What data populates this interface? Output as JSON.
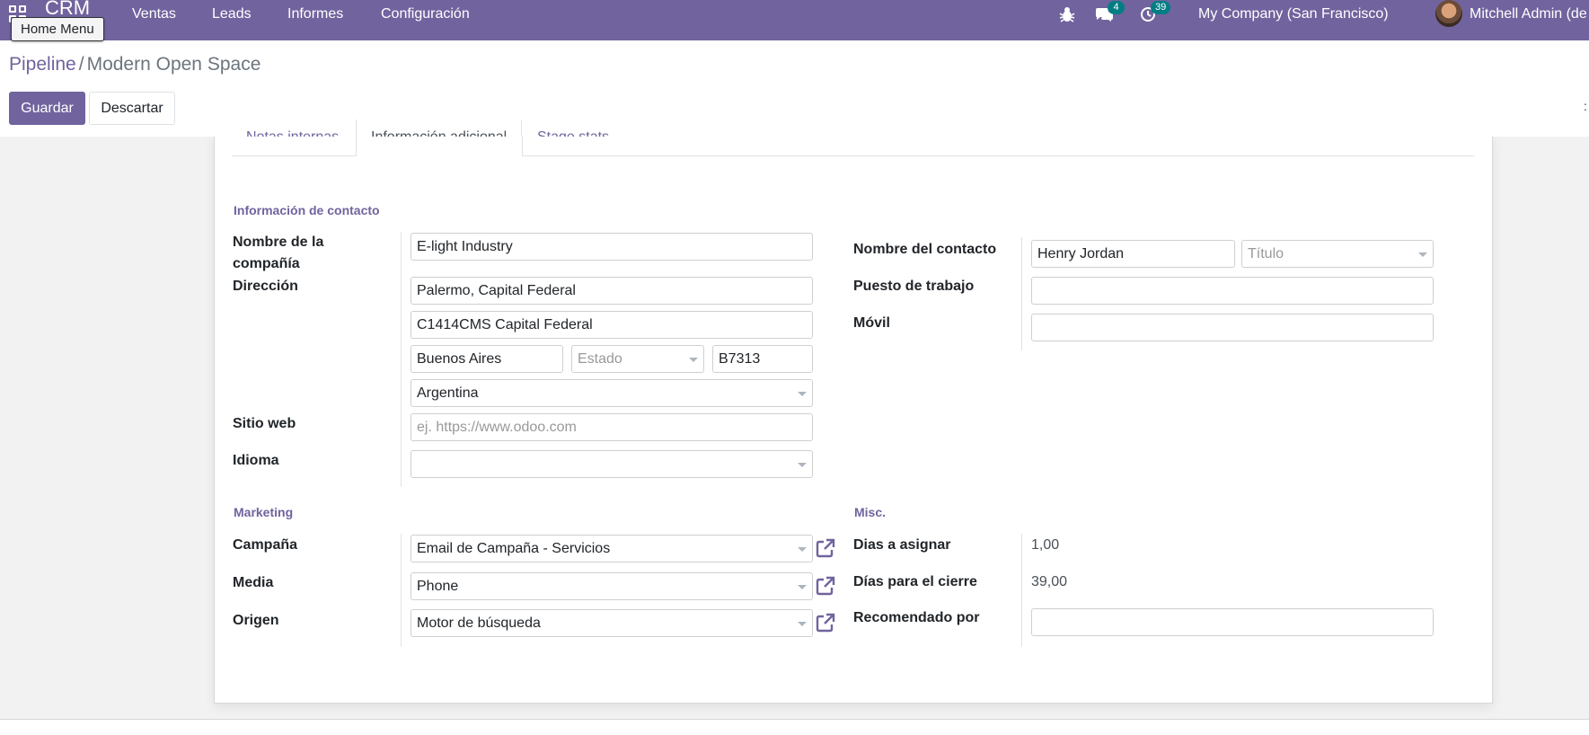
{
  "navbar": {
    "app_name": "CRM",
    "menu": [
      "Ventas",
      "Leads",
      "Informes",
      "Configuración"
    ],
    "tooltip": "Home Menu",
    "messages_count": "4",
    "activities_count": "39",
    "company": "My Company (San Francisco)",
    "user": "Mitchell Admin (de"
  },
  "breadcrumb": {
    "parent": "Pipeline",
    "separator": "/",
    "current": "Modern Open Space"
  },
  "buttons": {
    "save": "Guardar",
    "discard": "Descartar"
  },
  "tabs": [
    "Notas internas",
    "Información adicional",
    "Stage stats"
  ],
  "contact_section": {
    "title": "Información de contacto",
    "company_name_label": "Nombre de la compañía",
    "company_name": "E-light Industry",
    "address_label": "Dirección",
    "street": "Palermo, Capital Federal",
    "street2": "C1414CMS Capital Federal",
    "city": "Buenos Aires",
    "state_placeholder": "Estado",
    "zip": "B7313",
    "country": "Argentina",
    "website_label": "Sitio web",
    "website_placeholder": "ej. https://www.odoo.com",
    "language_label": "Idioma",
    "language": ""
  },
  "contact_right": {
    "contact_name_label": "Nombre del contacto",
    "contact_name": "Henry Jordan",
    "title_placeholder": "Título",
    "job_position_label": "Puesto de trabajo",
    "job_position": "",
    "mobile_label": "Móvil",
    "mobile": ""
  },
  "marketing": {
    "title": "Marketing",
    "campaign_label": "Campaña",
    "campaign": "Email de Campaña - Servicios",
    "medium_label": "Media",
    "medium": "Phone",
    "source_label": "Origen",
    "source": "Motor de búsqueda"
  },
  "misc": {
    "title": "Misc.",
    "days_to_assign_label": "Dias a asignar",
    "days_to_assign": "1,00",
    "days_to_close_label": "Días para el cierre",
    "days_to_close": "39,00",
    "referred_label": "Recomendado por",
    "referred": ""
  },
  "colors": {
    "brand": "#71639e",
    "badge": "#017e84"
  }
}
